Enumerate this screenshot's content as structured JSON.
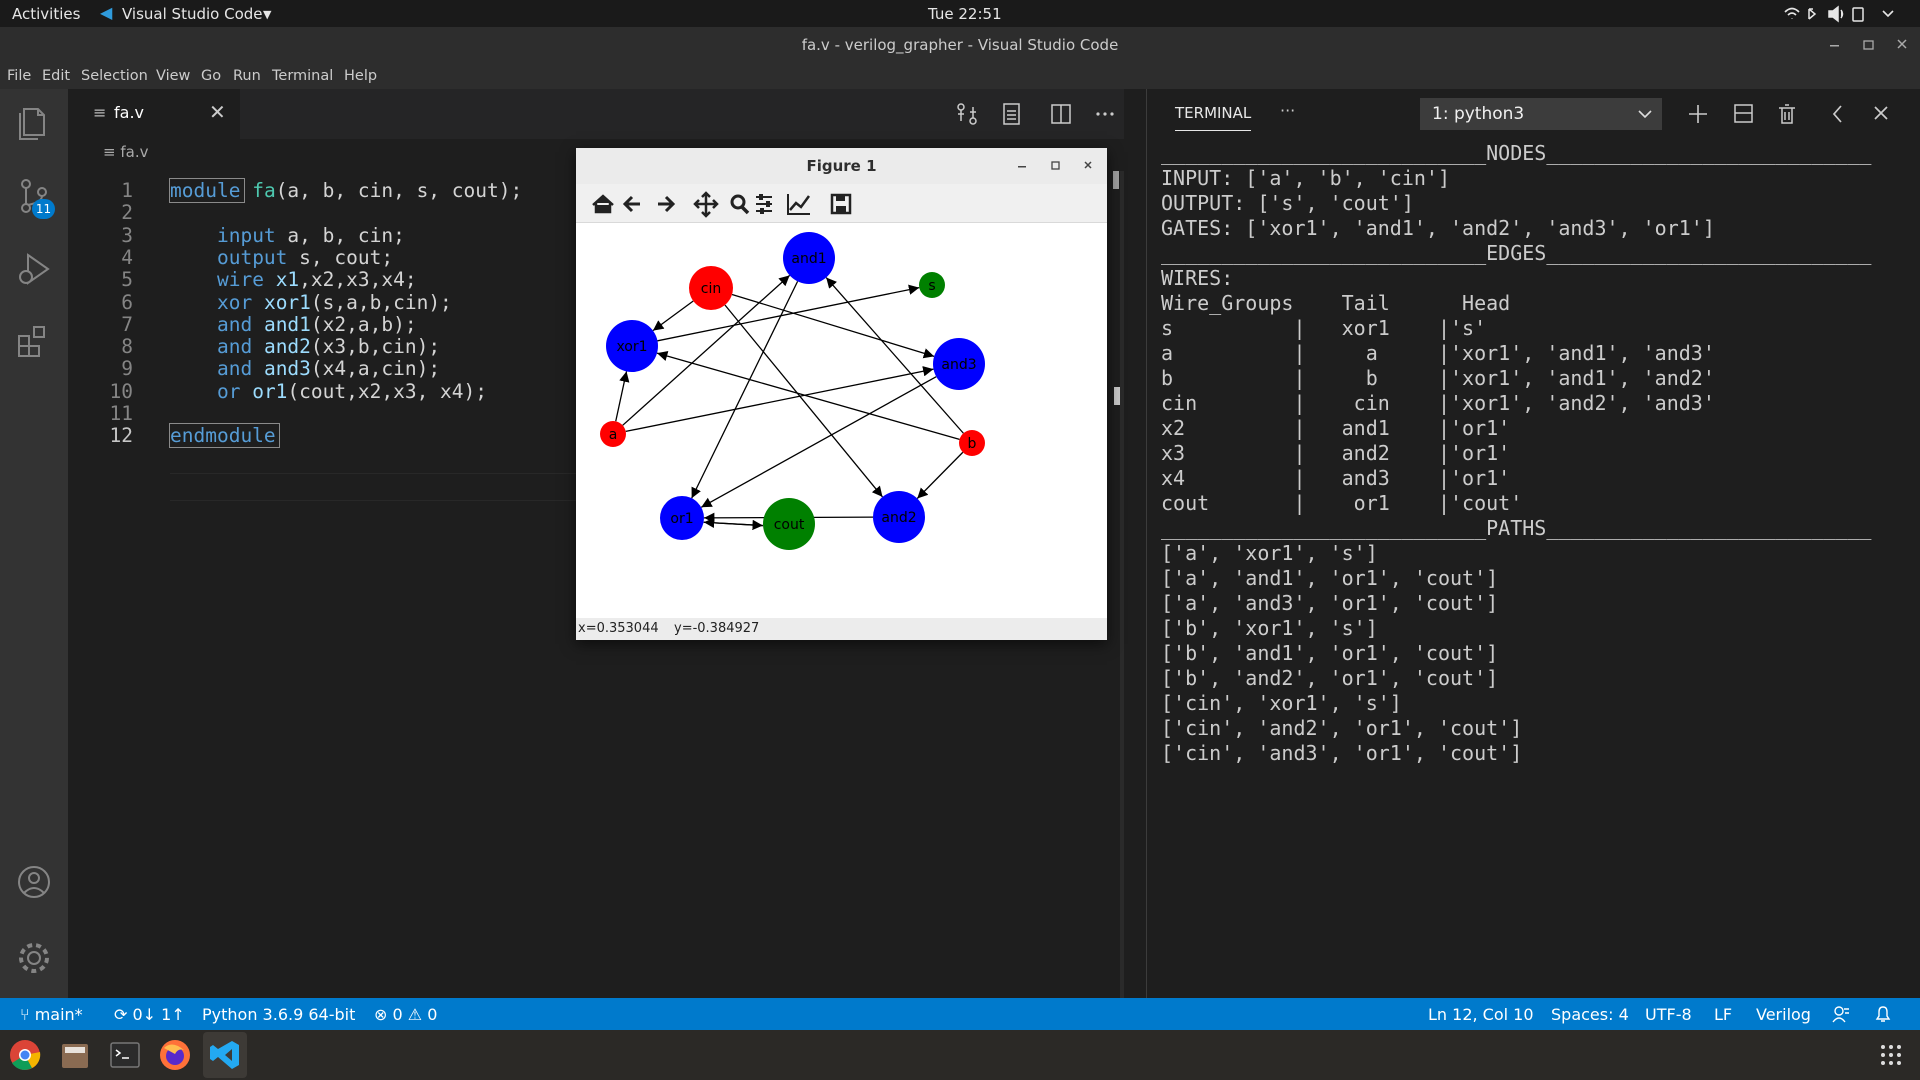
{
  "topbar": {
    "activities": "Activities",
    "app_name": "Visual Studio Code",
    "clock": "Tue 22:51"
  },
  "window": {
    "title": "fa.v - verilog_grapher - Visual Studio Code"
  },
  "menu": [
    "File",
    "Edit",
    "Selection",
    "View",
    "Go",
    "Run",
    "Terminal",
    "Help"
  ],
  "activity": {
    "scm_badge": "11"
  },
  "editor": {
    "tab_label": "fa.v",
    "breadcrumb": "fa.v",
    "lines": [
      {
        "n": "1",
        "tokens": [
          [
            "kw",
            "module"
          ],
          [
            "pl",
            " "
          ],
          [
            "fn",
            "fa"
          ],
          [
            "pl",
            "(a, b, cin, s, cout);"
          ]
        ]
      },
      {
        "n": "2",
        "tokens": []
      },
      {
        "n": "3",
        "tokens": [
          [
            "pl",
            "    "
          ],
          [
            "kw",
            "input"
          ],
          [
            "pl",
            " a, b, cin;"
          ]
        ]
      },
      {
        "n": "4",
        "tokens": [
          [
            "pl",
            "    "
          ],
          [
            "kw",
            "output"
          ],
          [
            "pl",
            " s, cout;"
          ]
        ]
      },
      {
        "n": "5",
        "tokens": [
          [
            "pl",
            "    "
          ],
          [
            "kw",
            "wire"
          ],
          [
            "pl",
            " "
          ],
          [
            "id",
            "x1"
          ],
          [
            "pl",
            ",x2,x3,x4;"
          ]
        ]
      },
      {
        "n": "6",
        "tokens": [
          [
            "pl",
            "    "
          ],
          [
            "kw",
            "xor"
          ],
          [
            "pl",
            " "
          ],
          [
            "id",
            "xor1"
          ],
          [
            "pl",
            "(s,a,b,cin);"
          ]
        ]
      },
      {
        "n": "7",
        "tokens": [
          [
            "pl",
            "    "
          ],
          [
            "kw",
            "and"
          ],
          [
            "pl",
            " "
          ],
          [
            "id",
            "and1"
          ],
          [
            "pl",
            "(x2,a,b);"
          ]
        ]
      },
      {
        "n": "8",
        "tokens": [
          [
            "pl",
            "    "
          ],
          [
            "kw",
            "and"
          ],
          [
            "pl",
            " "
          ],
          [
            "id",
            "and2"
          ],
          [
            "pl",
            "(x3,b,cin);"
          ]
        ]
      },
      {
        "n": "9",
        "tokens": [
          [
            "pl",
            "    "
          ],
          [
            "kw",
            "and"
          ],
          [
            "pl",
            " "
          ],
          [
            "id",
            "and3"
          ],
          [
            "pl",
            "(x4,a,cin);"
          ]
        ]
      },
      {
        "n": "10",
        "tokens": [
          [
            "pl",
            "    "
          ],
          [
            "kw",
            "or"
          ],
          [
            "pl",
            " "
          ],
          [
            "id",
            "or1"
          ],
          [
            "pl",
            "(cout,x2,x3, x4);"
          ]
        ]
      },
      {
        "n": "11",
        "tokens": []
      },
      {
        "n": "12",
        "tokens": [
          [
            "kw",
            "endmodule"
          ]
        ]
      }
    ]
  },
  "panel": {
    "tab_label": "TERMINAL",
    "more_label": "···",
    "terminal_select": "1: python3",
    "output_lines": [
      "___________________________NODES___________________________",
      "",
      "INPUT: ['a', 'b', 'cin']",
      "",
      "OUTPUT: ['s', 'cout']",
      "",
      "GATES: ['xor1', 'and1', 'and2', 'and3', 'or1']",
      "___________________________EDGES___________________________",
      "",
      "WIRES:",
      "Wire_Groups    Tail      Head",
      "s          |   xor1    |'s'",
      "a          |     a     |'xor1', 'and1', 'and3'",
      "b          |     b     |'xor1', 'and1', 'and2'",
      "cin        |    cin    |'xor1', 'and2', 'and3'",
      "x2         |   and1    |'or1'",
      "x3         |   and2    |'or1'",
      "x4         |   and3    |'or1'",
      "cout       |    or1    |'cout'",
      "",
      "",
      "",
      "___________________________PATHS___________________________",
      "",
      "['a', 'xor1', 's']",
      "['a', 'and1', 'or1', 'cout']",
      "['a', 'and3', 'or1', 'cout']",
      "['b', 'xor1', 's']",
      "['b', 'and1', 'or1', 'cout']",
      "['b', 'and2', 'or1', 'cout']",
      "['cin', 'xor1', 's']",
      "['cin', 'and2', 'or1', 'cout']",
      "['cin', 'and3', 'or1', 'cout']"
    ]
  },
  "figure": {
    "title": "Figure 1",
    "cursor_x": "x=0.353044",
    "cursor_y": "y=-0.384927",
    "colors": {
      "input": "#ff0000",
      "gate": "#0000ff",
      "output": "#008000"
    },
    "graph": {
      "nodes": [
        {
          "label": "and1",
          "kind": "gate"
        },
        {
          "label": "s",
          "kind": "output"
        },
        {
          "label": "cin",
          "kind": "input"
        },
        {
          "label": "xor1",
          "kind": "gate"
        },
        {
          "label": "and3",
          "kind": "gate"
        },
        {
          "label": "a",
          "kind": "input"
        },
        {
          "label": "b",
          "kind": "input"
        },
        {
          "label": "or1",
          "kind": "gate"
        },
        {
          "label": "cout",
          "kind": "output"
        },
        {
          "label": "and2",
          "kind": "gate"
        }
      ],
      "edges": [
        [
          "a",
          "xor1"
        ],
        [
          "a",
          "and1"
        ],
        [
          "a",
          "and3"
        ],
        [
          "b",
          "xor1"
        ],
        [
          "b",
          "and1"
        ],
        [
          "b",
          "and2"
        ],
        [
          "cin",
          "xor1"
        ],
        [
          "cin",
          "and2"
        ],
        [
          "cin",
          "and3"
        ],
        [
          "xor1",
          "s"
        ],
        [
          "and1",
          "or1"
        ],
        [
          "and2",
          "or1"
        ],
        [
          "and3",
          "or1"
        ],
        [
          "or1",
          "cout"
        ],
        [
          "cout",
          "or1"
        ]
      ]
    }
  },
  "status": {
    "branch": "main*",
    "sync": "0↓ 1↑",
    "interpreter": "Python 3.6.9 64-bit",
    "errors": "0",
    "warnings": "0",
    "position": "Ln 12, Col 10",
    "spaces": "Spaces: 4",
    "encoding": "UTF-8",
    "eol": "LF",
    "language": "Verilog"
  }
}
